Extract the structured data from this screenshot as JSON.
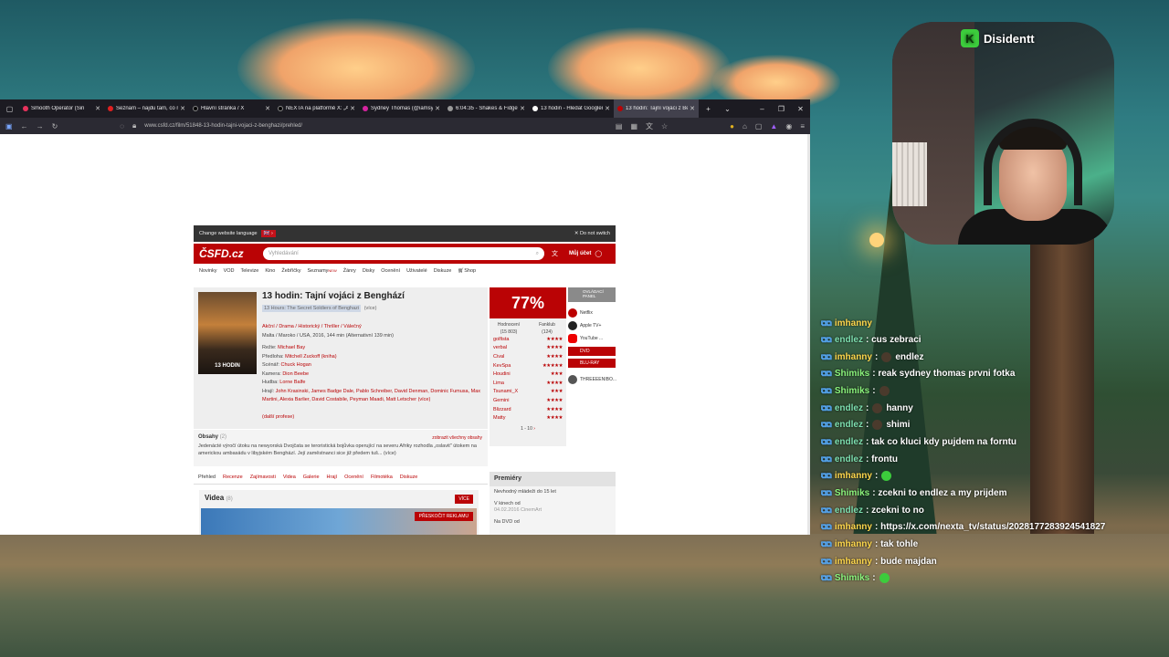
{
  "browser": {
    "tabs": [
      {
        "label": "Smooth Operator (Sin"
      },
      {
        "label": "Seznam – najdu tam, co ne"
      },
      {
        "label": "Hlavní stránka / X"
      },
      {
        "label": "NEXTA na platformě X: „Ar"
      },
      {
        "label": "Sydney Thomas (@iamsydn"
      },
      {
        "label": "6:04:35 - Shakes & Fidget"
      },
      {
        "label": "13 hodin - Hledat Googlem"
      },
      {
        "label": "13 hodin: Tajní vojáci z Ben"
      }
    ],
    "url": "www.csfd.cz/film/51848-13-hodin-tajni-vojaci-z-benghazi/prehled/"
  },
  "csfd": {
    "lang_label": "Change website language",
    "flag": "🇬🇧",
    "no_switch": "✕ Do not switch",
    "logo": "ČSFD.cz",
    "search_placeholder": "Vyhledávání",
    "account": "Můj účet",
    "menu": [
      "Novinky",
      "VOD",
      "Televize",
      "Kino",
      "Žebříčky",
      "Seznamy",
      "Žánry",
      "Disky",
      "Ocenění",
      "Uživatelé",
      "Diskuze",
      "Shop"
    ],
    "menu_new": "NEW",
    "poster_text": "13 HODIN",
    "title": "13 hodin: Tajní vojáci z Benghází",
    "original_title": "13 Hours: The Secret Soldiers of Benghazi",
    "original_suffix": "(více)",
    "genres": "Akční / Drama / Historický / Thriller / Válečný",
    "origin": "Malta / Maroko / USA, 2016, 144 min (Alternativní 139 min)",
    "crew": [
      {
        "role": "Režie:",
        "names": "Michael Bay"
      },
      {
        "role": "Předloha:",
        "names": "Mitchell Zuckoff (kniha)"
      },
      {
        "role": "Scénář:",
        "names": "Chuck Hogan"
      },
      {
        "role": "Kamera:",
        "names": "Dion Beebe"
      },
      {
        "role": "Hudba:",
        "names": "Lorne Balfe"
      },
      {
        "role": "Hrají:",
        "names": "John Krasinski, James Badge Dale, Pablo Schreiber, David Denman, Dominic Fumusa, Max Martini, Alexia Barlier, David Costabile, Peyman Maadi, Matt Letscher (více)"
      }
    ],
    "more_people": "(další profese)",
    "synopsis_title": "Obsahy",
    "synopsis_count": "(2)",
    "synopsis_more": "zobrazit všechny obsahy",
    "synopsis_text": "Jedenácté výročí útoku na newyorská Dvojčata se teroristická bojůvka operující na severu Afriky rozhodla „oslavit\" útokem na americkou ambasádu v libyjském Benghází. Její zaměstnanci sice již předem tuš... (více)",
    "subtabs": [
      "Přehled",
      "Recenze",
      "Zajímavosti",
      "Videa",
      "Galerie",
      "Hrají",
      "Ocenění",
      "Filmotéka",
      "Diskuze"
    ],
    "videos_title": "Videa",
    "videos_count": "(8)",
    "videos_more": "VÍCE",
    "ad_skip": "PŘESKOČIT REKLAMU",
    "rating_percent": "77%",
    "rating_tabs": [
      {
        "label": "Hodnocení",
        "count": "(15 803)"
      },
      {
        "label": "Fanklub",
        "count": "(124)"
      }
    ],
    "ratings": [
      {
        "user": "golfista",
        "stars": "★★★★"
      },
      {
        "user": "verbal",
        "stars": "★★★★"
      },
      {
        "user": "Cival",
        "stars": "★★★★"
      },
      {
        "user": "KevSpa",
        "stars": "★★★★★"
      },
      {
        "user": "Houdini",
        "stars": "★★★"
      },
      {
        "user": "Lima",
        "stars": "★★★★"
      },
      {
        "user": "Tsunami_X",
        "stars": "★★★"
      },
      {
        "user": "Gemini",
        "stars": "★★★★"
      },
      {
        "user": "Blizzard",
        "stars": "★★★★"
      },
      {
        "user": "Matty",
        "stars": "★★★★"
      }
    ],
    "pager": "1 - 10",
    "panel_label": "OVLÁDACÍ PANEL",
    "services": [
      "Netflix",
      "Apple TV+",
      "YouTube ..."
    ],
    "buy": [
      "DVD",
      "BLU-RAY"
    ],
    "extra_service": "THREEEENIBO...",
    "premiery_title": "Premiéry",
    "premiery": [
      {
        "text": "Nevhodný mládeži do 15 let"
      },
      {
        "text": "V kinech od",
        "sub": "04.02.2016 CinemArt"
      },
      {
        "text": "Na DVD od"
      }
    ]
  },
  "stream": {
    "channel": "Disidentt",
    "chat": [
      {
        "user": "imhanny",
        "text": "",
        "emote": "none",
        "color": "#ffd84d",
        "partial": true
      },
      {
        "user": "endlez",
        "text": ": cus zebraci",
        "color": "#7ee0b0"
      },
      {
        "user": "imhanny",
        "text": "endlez",
        "emote": "dark",
        "color": "#ffd84d"
      },
      {
        "user": "Shimiks",
        "text": ": reak sydney thomas prvni fotka",
        "color": "#8cf57d"
      },
      {
        "user": "Shimiks",
        "text": "",
        "emote": "dark",
        "color": "#8cf57d"
      },
      {
        "user": "endlez",
        "text": "hanny",
        "emote": "dark",
        "color": "#7ee0b0"
      },
      {
        "user": "endlez",
        "text": "shimi",
        "emote": "dark",
        "color": "#7ee0b0"
      },
      {
        "user": "endlez",
        "text": ": tak co kluci kdy pujdem na forntu",
        "color": "#7ee0b0"
      },
      {
        "user": "endlez",
        "text": ": frontu",
        "color": "#7ee0b0"
      },
      {
        "user": "imhanny",
        "text": "",
        "emote": "green",
        "color": "#ffd84d"
      },
      {
        "user": "Shimiks",
        "text": ": zcekni to endlez a my prijdem",
        "color": "#8cf57d"
      },
      {
        "user": "endlez",
        "text": ": zcekni to no",
        "color": "#7ee0b0"
      },
      {
        "user": "imhanny",
        "text": ": https://x.com/nexta_tv/status/2028177283924541827",
        "color": "#ffd84d"
      },
      {
        "user": "imhanny",
        "text": ": tak tohle",
        "color": "#ffd84d"
      },
      {
        "user": "imhanny",
        "text": ": bude majdan",
        "color": "#ffd84d"
      },
      {
        "user": "Shimiks",
        "text": "",
        "emote": "green",
        "color": "#8cf57d"
      }
    ]
  }
}
